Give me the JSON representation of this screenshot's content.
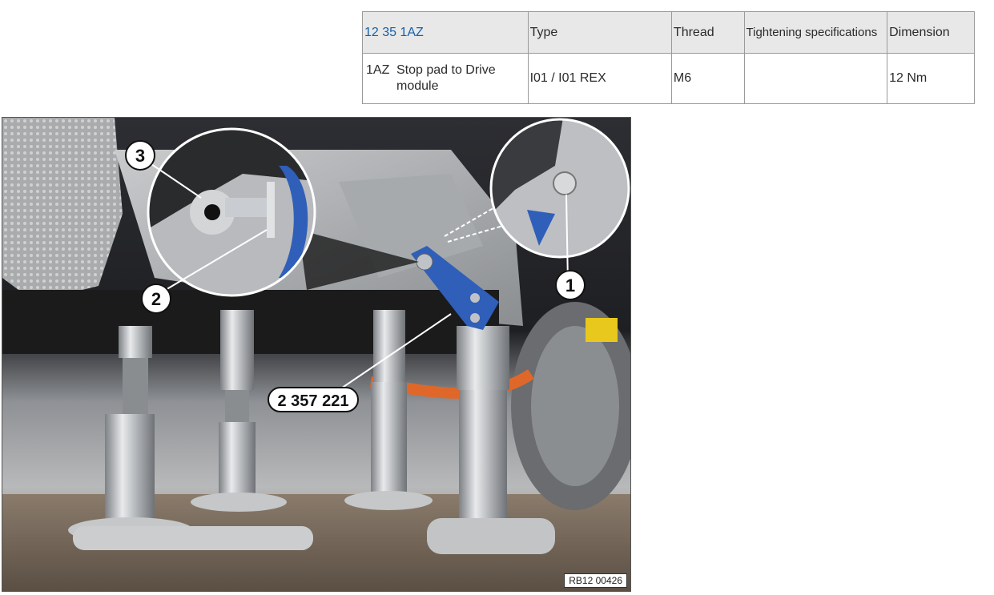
{
  "table": {
    "headers": {
      "code": "12 35 1AZ",
      "type": "Type",
      "thread": "Thread",
      "tightening": "Tightening specifications",
      "dimension": "Dimension"
    },
    "rows": [
      {
        "item_code": "1AZ",
        "item_desc": "Stop pad to Drive module",
        "type": "I01 / I01 REX",
        "thread": "M6",
        "tightening": "",
        "dimension": "12 Nm"
      }
    ]
  },
  "figure": {
    "callouts": {
      "c1": "1",
      "c2": "2",
      "c3": "3",
      "tool": "2 357 221"
    },
    "reference": "RB12 00426"
  }
}
